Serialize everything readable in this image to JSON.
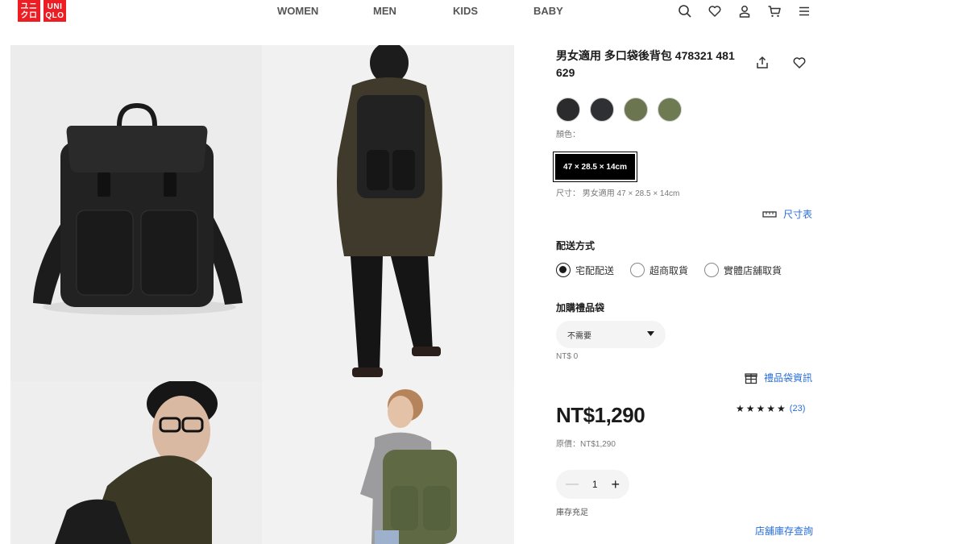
{
  "header": {
    "logo_top": "ユニ\nクロ",
    "logo_bottom": "UNI\nQLO",
    "nav": [
      "WOMEN",
      "MEN",
      "KIDS",
      "BABY"
    ],
    "icons": [
      "search-icon",
      "heart-icon",
      "user-icon",
      "cart-icon",
      "menu-icon"
    ]
  },
  "gallery": {
    "images": [
      "backpack-product-photo",
      "man-wearing-backpack-rear",
      "man-with-glasses-backpack",
      "woman-with-olive-backpack"
    ]
  },
  "product": {
    "title": "男女適用 多口袋後背包 478321 481 629",
    "colors": [
      "#2b2b2d",
      "#2f3033",
      "#6b7550",
      "#6d7a52"
    ],
    "color_label": "顏色：",
    "size_chip": "47 × 28.5 × 14cm",
    "size_label": "尺寸： 男女適用 47 × 28.5 × 14cm",
    "size_chart": "尺寸表",
    "delivery_title": "配送方式",
    "delivery_options": [
      "宅配配送",
      "超商取貨",
      "實體店舖取貨"
    ],
    "delivery_selected": 0,
    "gift_title": "加購禮品袋",
    "gift_select": "不需要",
    "gift_price": "NT$ 0",
    "gift_info": "禮品袋資訊",
    "price": "NT$1,290",
    "orig_price": "原價：NT$1,290",
    "rating_stars": "★★★★★",
    "rating_value": 5,
    "rating_count": "(23)",
    "quantity": "1",
    "stock": "庫存充足",
    "store_stock": "店舖庫存查詢"
  },
  "colors": {
    "brand": "#ed1d24",
    "link": "#2a6ed6"
  }
}
